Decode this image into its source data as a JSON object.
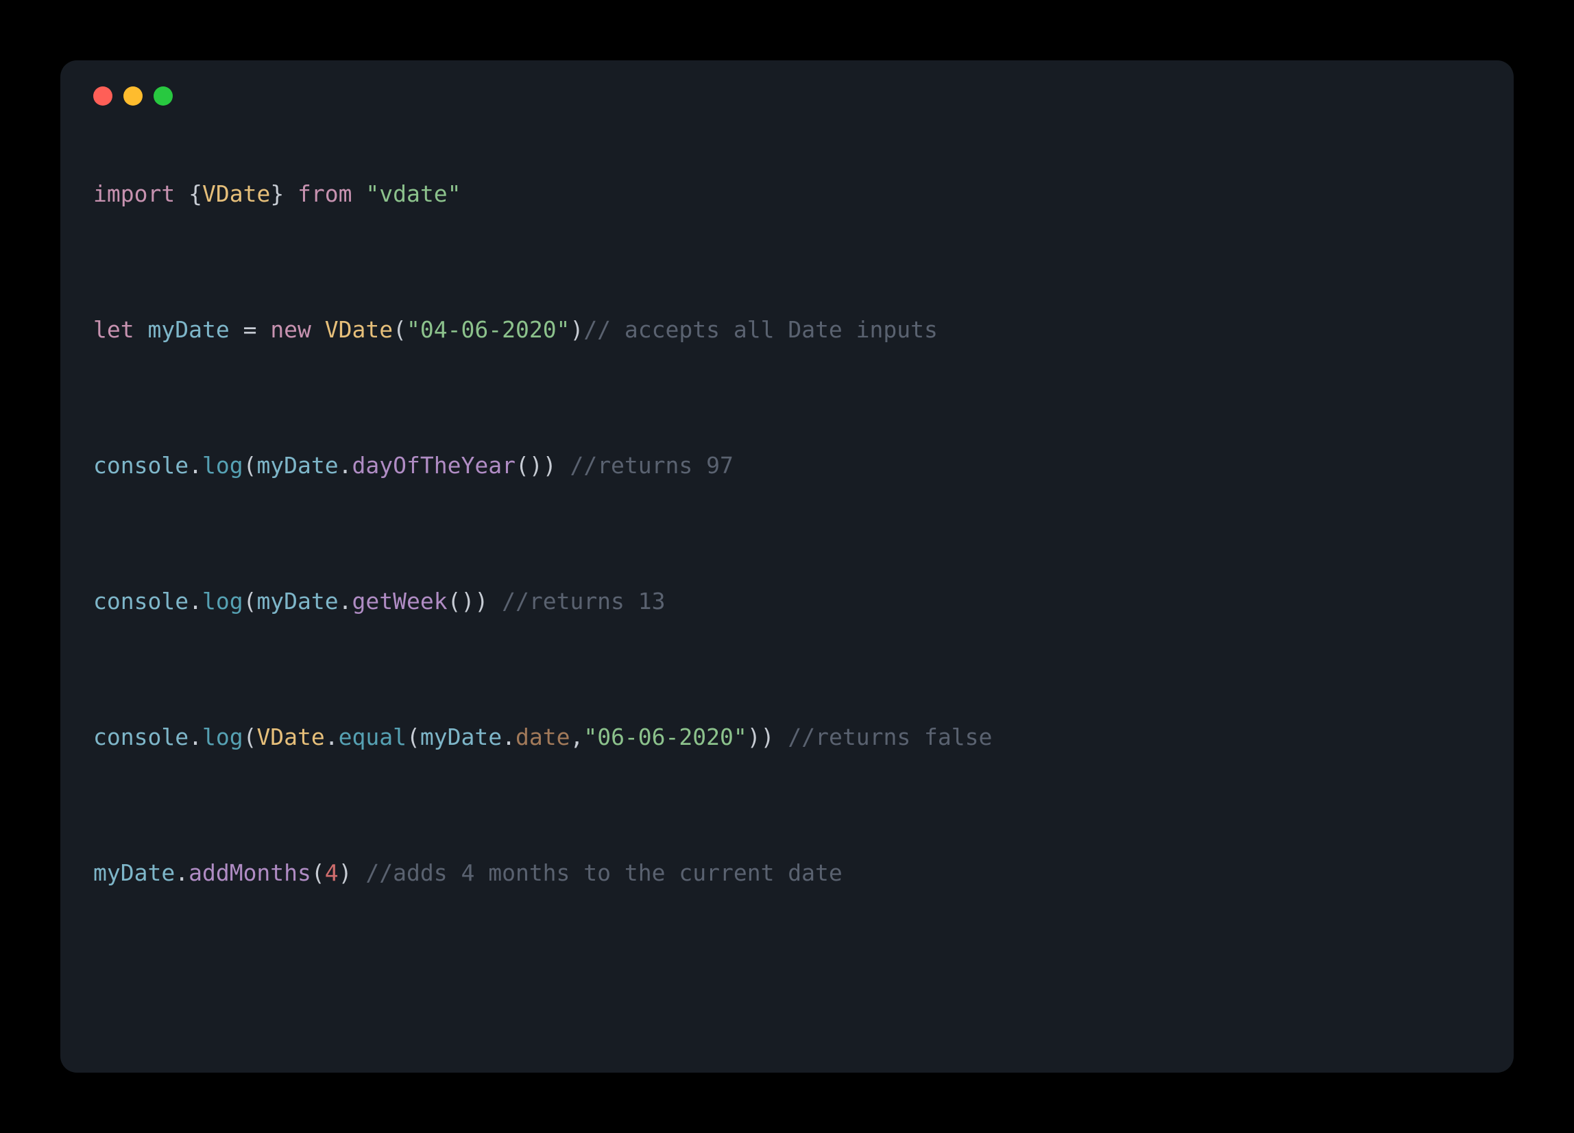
{
  "code": {
    "l1_import": "import",
    "l1_brace_open": " {",
    "l1_vdate": "VDate",
    "l1_brace_close": "}",
    "l1_from": " from ",
    "l1_str": "\"vdate\"",
    "l3_let": "let",
    "l3_sp1": " ",
    "l3_mydate": "myDate",
    "l3_eq": " = ",
    "l3_new": "new",
    "l3_sp2": " ",
    "l3_vdate": "VDate",
    "l3_paren_o": "(",
    "l3_str": "\"04-06-2020\"",
    "l3_paren_c": ")",
    "l3_comment": "// accepts all Date inputs",
    "l5_console": "console",
    "l5_dot": ".",
    "l5_log": "log",
    "l5_po": "(",
    "l5_mydate": "myDate",
    "l5_dot2": ".",
    "l5_method": "dayOfTheYear",
    "l5_pp": "()",
    "l5_pc": ")",
    "l5_sp": " ",
    "l5_comment": "//returns 97",
    "l7_console": "console",
    "l7_dot": ".",
    "l7_log": "log",
    "l7_po": "(",
    "l7_mydate": "myDate",
    "l7_dot2": ".",
    "l7_method": "getWeek",
    "l7_pp": "()",
    "l7_pc": ")",
    "l7_sp": " ",
    "l7_comment": "//returns 13",
    "l9_console": "console",
    "l9_dot": ".",
    "l9_log": "log",
    "l9_po": "(",
    "l9_vdate": "VDate",
    "l9_dot2": ".",
    "l9_equal": "equal",
    "l9_po2": "(",
    "l9_mydate": "myDate",
    "l9_dot3": ".",
    "l9_date": "date",
    "l9_comma": ",",
    "l9_str": "\"06-06-2020\"",
    "l9_pc2": ")",
    "l9_pc": ")",
    "l9_sp": " ",
    "l9_comment": "//returns false",
    "l11_mydate": "myDate",
    "l11_dot": ".",
    "l11_method": "addMonths",
    "l11_po": "(",
    "l11_num": "4",
    "l11_pc": ")",
    "l11_sp": " ",
    "l11_comment": "//adds 4 months to the current date"
  }
}
